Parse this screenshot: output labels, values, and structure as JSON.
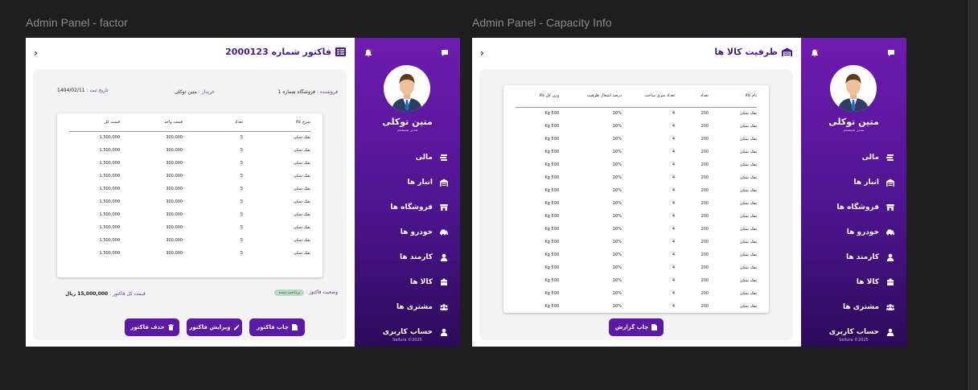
{
  "frames": {
    "factor_title": "Admin Panel - factor",
    "capacity_title": "Admin Panel - Capacity Info"
  },
  "sidebar": {
    "user_name": "متین توکلی",
    "user_role": "مدیر سیستم",
    "items": [
      {
        "label": "مالی",
        "icon": "money-stack-icon"
      },
      {
        "label": "انبار ها",
        "icon": "warehouse-icon"
      },
      {
        "label": "فروشگاه ها",
        "icon": "store-icon"
      },
      {
        "label": "خودرو ها",
        "icon": "cars-icon"
      },
      {
        "label": "کارمند ها",
        "icon": "employee-icon"
      },
      {
        "label": "کالا ها",
        "icon": "box-icon"
      },
      {
        "label": "مشتری ها",
        "icon": "customers-icon"
      },
      {
        "label": "حساب کاربری",
        "icon": "user-account-icon"
      }
    ],
    "copyright": "Sellura ©2025"
  },
  "factor": {
    "title": "فاکتور شماره 2000123",
    "seller_label": "فروشنده :",
    "seller_value": "فروشگاه شماره 1",
    "buyer_label": "خریدار :",
    "buyer_value": "متین توکلی",
    "date_label": "تاریخ ثبت :",
    "date_value": "1404/02/11",
    "columns": [
      "شرح کالا",
      "تعداد",
      "قیمت واحد",
      "قیمت کل"
    ],
    "rows": [
      [
        "پفک نمکی",
        "5",
        "300,000",
        "1,500,000"
      ],
      [
        "پفک نمکی",
        "5",
        "300,000",
        "1,500,000"
      ],
      [
        "پفک نمکی",
        "5",
        "300,000",
        "1,500,000"
      ],
      [
        "پفک نمکی",
        "5",
        "300,000",
        "1,500,000"
      ],
      [
        "پفک نمکی",
        "5",
        "300,000",
        "1,500,000"
      ],
      [
        "پفک نمکی",
        "5",
        "300,000",
        "1,500,000"
      ],
      [
        "پفک نمکی",
        "5",
        "300,000",
        "1,500,000"
      ],
      [
        "پفک نمکی",
        "5",
        "300,000",
        "1,500,000"
      ],
      [
        "پفک نمکی",
        "5",
        "300,000",
        "1,500,000"
      ],
      [
        "پفک نمکی",
        "5",
        "300,000",
        "1,500,000"
      ]
    ],
    "status_label": "وضعیت فاکتور :",
    "status_value": "پرداخت شده",
    "total_label": "قیمت کل فاکتور :",
    "total_value": "15,000,000 ریال",
    "print_button": "چاپ فاکتور",
    "edit_button": "ویرایش فاکتور",
    "delete_button": "حذف فاکتور"
  },
  "capacity": {
    "title": "ظرفیت کالا ها",
    "columns": [
      "نام کالا",
      "تعداد",
      "تعداد متری ساخت",
      "درصد اشغال ظرفیت",
      "وزن کل کالا"
    ],
    "rows": [
      [
        "پفک نمکی",
        "200",
        "4",
        "10%",
        "500 Kg"
      ],
      [
        "پفک نمکی",
        "200",
        "4",
        "10%",
        "500 Kg"
      ],
      [
        "پفک نمکی",
        "200",
        "4",
        "10%",
        "500 Kg"
      ],
      [
        "پفک نمکی",
        "200",
        "4",
        "10%",
        "500 Kg"
      ],
      [
        "پفک نمکی",
        "200",
        "4",
        "10%",
        "500 Kg"
      ],
      [
        "پفک نمکی",
        "200",
        "4",
        "10%",
        "500 Kg"
      ],
      [
        "پفک نمکی",
        "200",
        "4",
        "10%",
        "500 Kg"
      ],
      [
        "پفک نمکی",
        "200",
        "4",
        "10%",
        "500 Kg"
      ],
      [
        "پفک نمکی",
        "200",
        "4",
        "10%",
        "500 Kg"
      ],
      [
        "پفک نمکی",
        "200",
        "4",
        "10%",
        "500 Kg"
      ],
      [
        "پفک نمکی",
        "200",
        "4",
        "10%",
        "500 Kg"
      ],
      [
        "پفک نمکی",
        "200",
        "4",
        "10%",
        "500 Kg"
      ],
      [
        "پفک نمکی",
        "200",
        "4",
        "10%",
        "500 Kg"
      ],
      [
        "پفک نمکی",
        "200",
        "4",
        "10%",
        "500 Kg"
      ],
      [
        "پفک نمکی",
        "200",
        "4",
        "10%",
        "500 Kg"
      ],
      [
        "پفک نمکی",
        "200",
        "4",
        "10%",
        "500 Kg"
      ]
    ],
    "print_button": "چاپ گزارش"
  },
  "colors": {
    "accent": "#5b1aa6",
    "sidebar_top": "#6e1cb0",
    "sidebar_bottom": "#2c0a5a",
    "status_paid": "#b9d9c2"
  }
}
